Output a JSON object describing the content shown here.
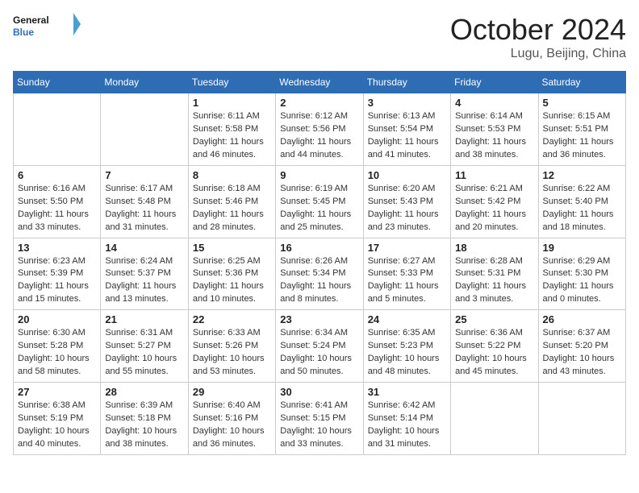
{
  "header": {
    "logo_general": "General",
    "logo_blue": "Blue",
    "month_title": "October 2024",
    "location": "Lugu, Beijing, China"
  },
  "weekdays": [
    "Sunday",
    "Monday",
    "Tuesday",
    "Wednesday",
    "Thursday",
    "Friday",
    "Saturday"
  ],
  "weeks": [
    [
      {
        "day": "",
        "info": ""
      },
      {
        "day": "",
        "info": ""
      },
      {
        "day": "1",
        "info": "Sunrise: 6:11 AM\nSunset: 5:58 PM\nDaylight: 11 hours and 46 minutes."
      },
      {
        "day": "2",
        "info": "Sunrise: 6:12 AM\nSunset: 5:56 PM\nDaylight: 11 hours and 44 minutes."
      },
      {
        "day": "3",
        "info": "Sunrise: 6:13 AM\nSunset: 5:54 PM\nDaylight: 11 hours and 41 minutes."
      },
      {
        "day": "4",
        "info": "Sunrise: 6:14 AM\nSunset: 5:53 PM\nDaylight: 11 hours and 38 minutes."
      },
      {
        "day": "5",
        "info": "Sunrise: 6:15 AM\nSunset: 5:51 PM\nDaylight: 11 hours and 36 minutes."
      }
    ],
    [
      {
        "day": "6",
        "info": "Sunrise: 6:16 AM\nSunset: 5:50 PM\nDaylight: 11 hours and 33 minutes."
      },
      {
        "day": "7",
        "info": "Sunrise: 6:17 AM\nSunset: 5:48 PM\nDaylight: 11 hours and 31 minutes."
      },
      {
        "day": "8",
        "info": "Sunrise: 6:18 AM\nSunset: 5:46 PM\nDaylight: 11 hours and 28 minutes."
      },
      {
        "day": "9",
        "info": "Sunrise: 6:19 AM\nSunset: 5:45 PM\nDaylight: 11 hours and 25 minutes."
      },
      {
        "day": "10",
        "info": "Sunrise: 6:20 AM\nSunset: 5:43 PM\nDaylight: 11 hours and 23 minutes."
      },
      {
        "day": "11",
        "info": "Sunrise: 6:21 AM\nSunset: 5:42 PM\nDaylight: 11 hours and 20 minutes."
      },
      {
        "day": "12",
        "info": "Sunrise: 6:22 AM\nSunset: 5:40 PM\nDaylight: 11 hours and 18 minutes."
      }
    ],
    [
      {
        "day": "13",
        "info": "Sunrise: 6:23 AM\nSunset: 5:39 PM\nDaylight: 11 hours and 15 minutes."
      },
      {
        "day": "14",
        "info": "Sunrise: 6:24 AM\nSunset: 5:37 PM\nDaylight: 11 hours and 13 minutes."
      },
      {
        "day": "15",
        "info": "Sunrise: 6:25 AM\nSunset: 5:36 PM\nDaylight: 11 hours and 10 minutes."
      },
      {
        "day": "16",
        "info": "Sunrise: 6:26 AM\nSunset: 5:34 PM\nDaylight: 11 hours and 8 minutes."
      },
      {
        "day": "17",
        "info": "Sunrise: 6:27 AM\nSunset: 5:33 PM\nDaylight: 11 hours and 5 minutes."
      },
      {
        "day": "18",
        "info": "Sunrise: 6:28 AM\nSunset: 5:31 PM\nDaylight: 11 hours and 3 minutes."
      },
      {
        "day": "19",
        "info": "Sunrise: 6:29 AM\nSunset: 5:30 PM\nDaylight: 11 hours and 0 minutes."
      }
    ],
    [
      {
        "day": "20",
        "info": "Sunrise: 6:30 AM\nSunset: 5:28 PM\nDaylight: 10 hours and 58 minutes."
      },
      {
        "day": "21",
        "info": "Sunrise: 6:31 AM\nSunset: 5:27 PM\nDaylight: 10 hours and 55 minutes."
      },
      {
        "day": "22",
        "info": "Sunrise: 6:33 AM\nSunset: 5:26 PM\nDaylight: 10 hours and 53 minutes."
      },
      {
        "day": "23",
        "info": "Sunrise: 6:34 AM\nSunset: 5:24 PM\nDaylight: 10 hours and 50 minutes."
      },
      {
        "day": "24",
        "info": "Sunrise: 6:35 AM\nSunset: 5:23 PM\nDaylight: 10 hours and 48 minutes."
      },
      {
        "day": "25",
        "info": "Sunrise: 6:36 AM\nSunset: 5:22 PM\nDaylight: 10 hours and 45 minutes."
      },
      {
        "day": "26",
        "info": "Sunrise: 6:37 AM\nSunset: 5:20 PM\nDaylight: 10 hours and 43 minutes."
      }
    ],
    [
      {
        "day": "27",
        "info": "Sunrise: 6:38 AM\nSunset: 5:19 PM\nDaylight: 10 hours and 40 minutes."
      },
      {
        "day": "28",
        "info": "Sunrise: 6:39 AM\nSunset: 5:18 PM\nDaylight: 10 hours and 38 minutes."
      },
      {
        "day": "29",
        "info": "Sunrise: 6:40 AM\nSunset: 5:16 PM\nDaylight: 10 hours and 36 minutes."
      },
      {
        "day": "30",
        "info": "Sunrise: 6:41 AM\nSunset: 5:15 PM\nDaylight: 10 hours and 33 minutes."
      },
      {
        "day": "31",
        "info": "Sunrise: 6:42 AM\nSunset: 5:14 PM\nDaylight: 10 hours and 31 minutes."
      },
      {
        "day": "",
        "info": ""
      },
      {
        "day": "",
        "info": ""
      }
    ]
  ]
}
